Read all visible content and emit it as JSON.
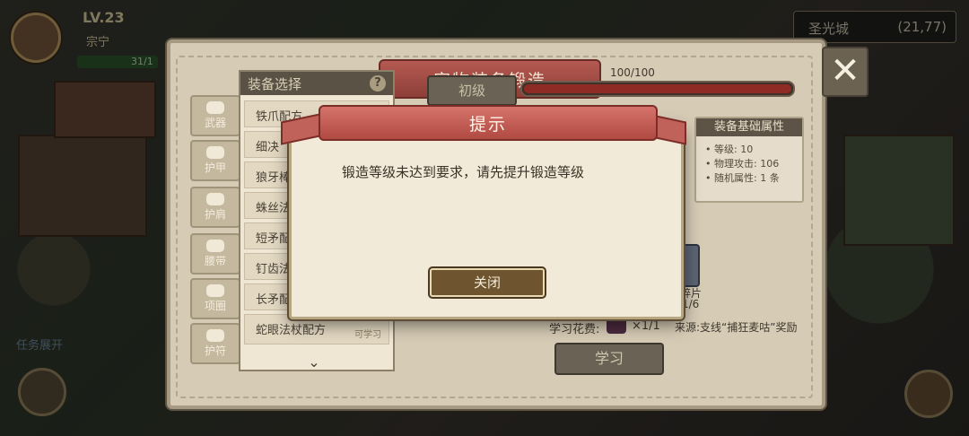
{
  "hud": {
    "level": "LV.23",
    "player_name": "宗宁",
    "hp_text": "31/1"
  },
  "location": {
    "name": "圣光城",
    "coords": "(21,77)"
  },
  "panel": {
    "title": "宠物装备锻造",
    "close_icon": "✕",
    "categories": [
      {
        "label": "武器",
        "icon": "sword-icon"
      },
      {
        "label": "护甲",
        "icon": "armor-icon"
      },
      {
        "label": "护肩",
        "icon": "shoulder-icon"
      },
      {
        "label": "腰带",
        "icon": "belt-icon"
      },
      {
        "label": "项圈",
        "icon": "collar-icon"
      },
      {
        "label": "护符",
        "icon": "amulet-icon"
      }
    ],
    "list": {
      "title": "装备选择",
      "help": "?",
      "items": [
        {
          "name": "铁爪配方",
          "tag": ""
        },
        {
          "name": "细决",
          "tag": ""
        },
        {
          "name": "狼牙棒",
          "tag": ""
        },
        {
          "name": "蛛丝法",
          "tag": ""
        },
        {
          "name": "短矛配",
          "tag": ""
        },
        {
          "name": "钉齿法",
          "tag": ""
        },
        {
          "name": "长矛配",
          "tag": ""
        },
        {
          "name": "蛇眼法杖配方",
          "tag": "可学习"
        }
      ]
    },
    "level_label": "初级",
    "progress": {
      "text": "100/100",
      "value": 1.0
    },
    "attributes": {
      "title": "装备基础属性",
      "lines": [
        "等级: 10",
        "物理攻击: 106",
        "随机属性: 1 条"
      ]
    },
    "fragment": {
      "label": "碎片",
      "count": "1/6"
    },
    "cost": {
      "label": "学习花费:",
      "count": "×1/1"
    },
    "source": "来源:支线“捕狂麦咕”奖励",
    "learn_button": "学习"
  },
  "modal": {
    "title": "提示",
    "message": "锻造等级未达到要求，请先提升锻造等级",
    "close_button": "关闭"
  },
  "mission": "任务展开"
}
